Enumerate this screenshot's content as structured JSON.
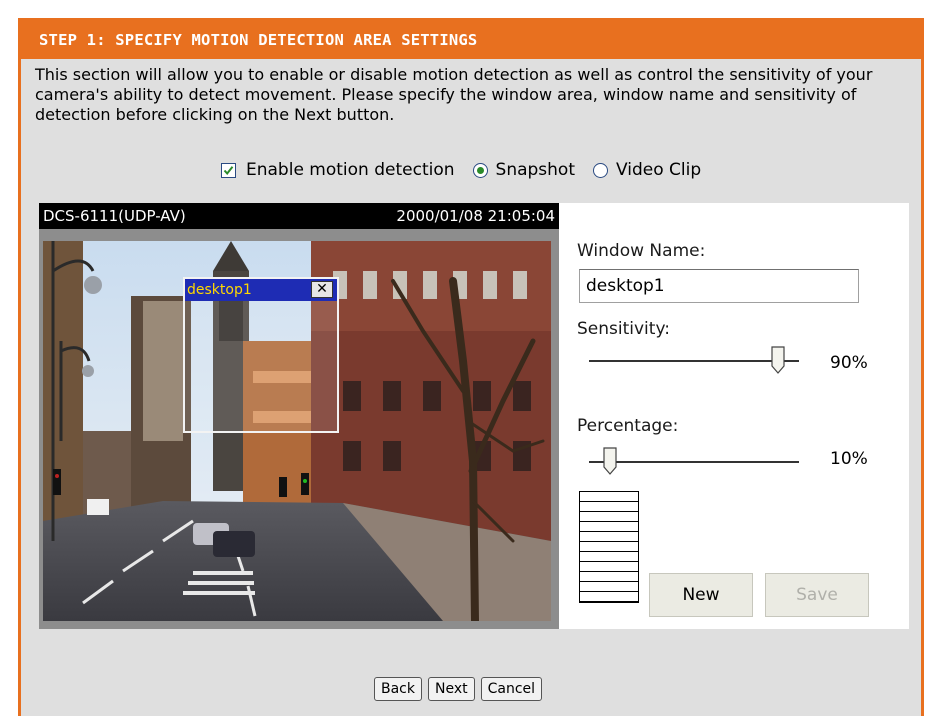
{
  "header": {
    "title": "STEP 1: SPECIFY MOTION DETECTION AREA SETTINGS"
  },
  "description": "This section will allow you to enable or disable motion detection as well as control the sensitivity of your camera's ability to detect movement. Please specify the window area, window name and sensitivity of detection before clicking on the Next button.",
  "options": {
    "enable_label": "Enable motion detection",
    "enable_checked": true,
    "snapshot_label": "Snapshot",
    "videoclip_label": "Video Clip",
    "selected": "Snapshot"
  },
  "camera": {
    "name": "DCS-6111(UDP-AV)",
    "timestamp": "2000/01/08 21:05:04",
    "detection_window": {
      "title": "desktop1",
      "close_glyph": "✕"
    }
  },
  "settings": {
    "window_name_label": "Window Name:",
    "window_name_value": "desktop1",
    "sensitivity_label": "Sensitivity:",
    "sensitivity_value": "90%",
    "sensitivity_fraction": 0.9,
    "percentage_label": "Percentage:",
    "percentage_value": "10%",
    "percentage_fraction": 0.1,
    "new_button": "New",
    "save_button": "Save"
  },
  "navigation": {
    "back": "Back",
    "next": "Next",
    "cancel": "Cancel"
  },
  "colors": {
    "accent": "#e8701f",
    "panel": "#dfdfdf",
    "window_title_bar": "#1e2cb4",
    "window_title_text": "#ffd800"
  }
}
